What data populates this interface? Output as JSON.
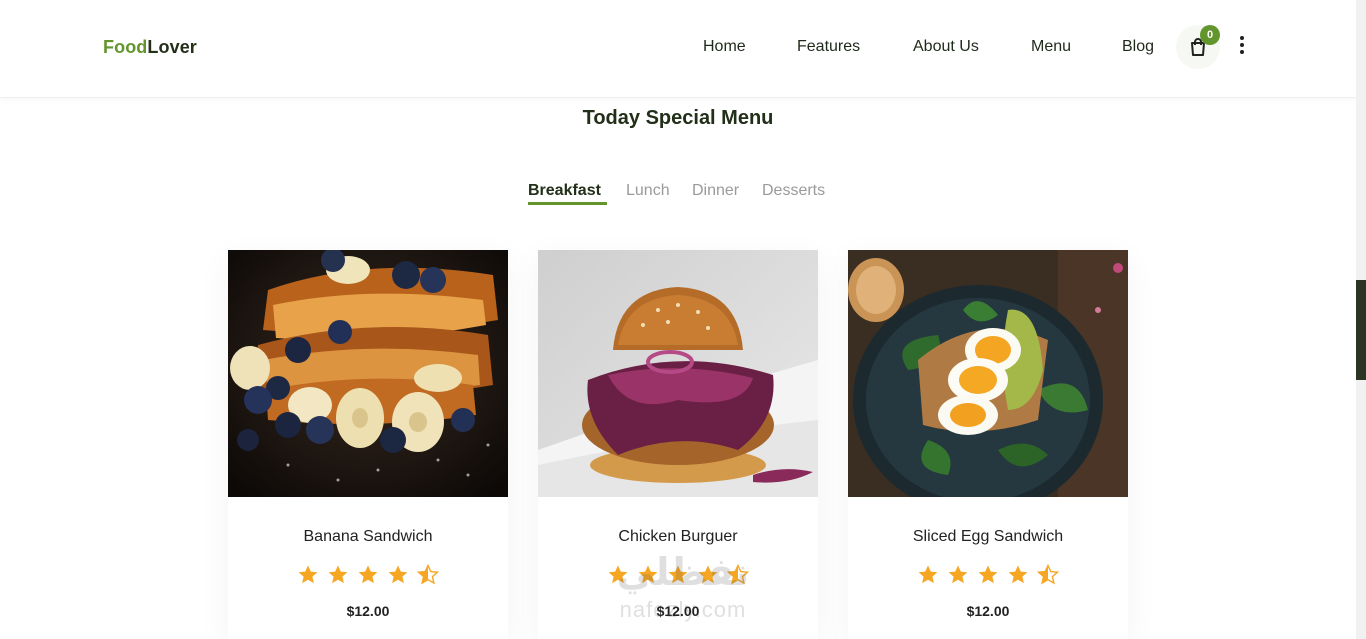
{
  "header": {
    "logo_part1": "Food",
    "logo_part2": "Lover",
    "nav": [
      "Home",
      "Features",
      "About Us",
      "Menu",
      "Blog"
    ],
    "cart_count": "0"
  },
  "section": {
    "title": "Today Special Menu",
    "tabs": [
      "Breakfast",
      "Lunch",
      "Dinner",
      "Desserts"
    ],
    "active_tab": "Breakfast"
  },
  "cards": [
    {
      "name": "Banana Sandwich",
      "price": "$12.00",
      "rating": 4.5
    },
    {
      "name": "Chicken Burguer",
      "price": "$12.00",
      "rating": 4.5
    },
    {
      "name": "Sliced Egg Sandwich",
      "price": "$12.00",
      "rating": 4.5
    }
  ],
  "watermark": {
    "line1": "نفظلي",
    "line2": "nafezly.com"
  },
  "colors": {
    "brand_green": "#62962c",
    "dark_text": "#222f19",
    "star": "#f5a623",
    "muted": "#9a9a9a"
  }
}
